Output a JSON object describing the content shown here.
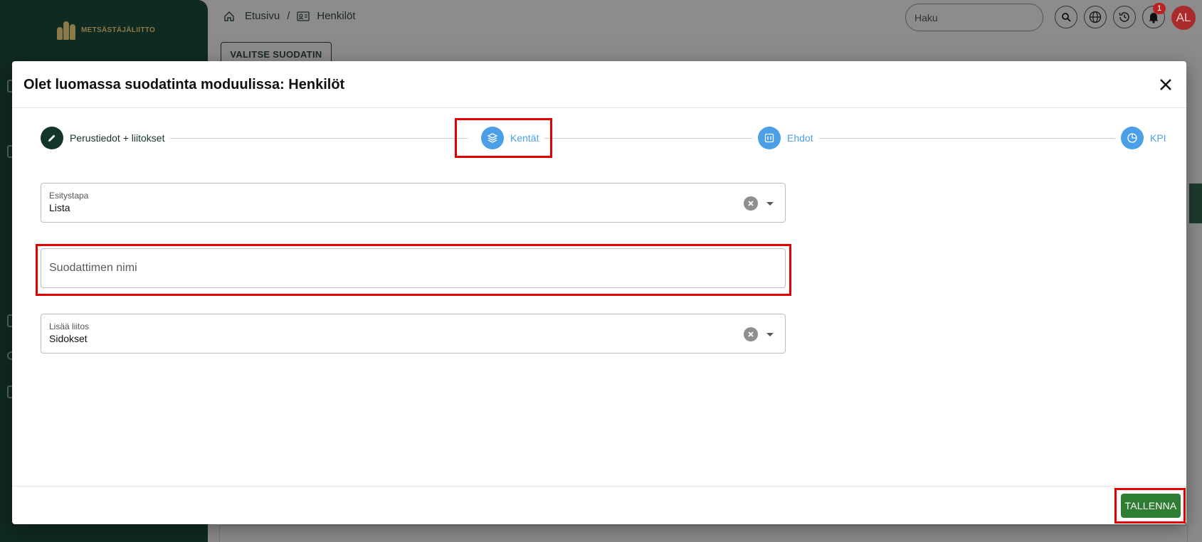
{
  "app": {
    "logo_text": "METSÄSTÄJÄLIITTO"
  },
  "breadcrumb": {
    "home": "Etusivu",
    "separator": "/",
    "current": "Henkilöt"
  },
  "search": {
    "placeholder": "Haku"
  },
  "toolbar": {
    "notification_count": "1",
    "avatar_initials": "AL",
    "filter_button": "VALITSE SUODATIN"
  },
  "modal": {
    "title": "Olet luomassa suodatinta moduulissa: Henkilöt",
    "steps": [
      {
        "label": "Perustiedot + liitokset",
        "icon": "pencil-icon",
        "state": "done"
      },
      {
        "label": "Kentät",
        "icon": "layers-icon",
        "state": "active"
      },
      {
        "label": "Ehdot",
        "icon": "grid-icon",
        "state": "pending"
      },
      {
        "label": "KPI",
        "icon": "pie-chart-icon",
        "state": "pending"
      }
    ],
    "fields": {
      "presentation": {
        "label": "Esitystapa",
        "value": "Lista"
      },
      "filter_name": {
        "placeholder": "Suodattimen nimi",
        "value": ""
      },
      "add_join": {
        "label": "Lisää liitos",
        "value": "Sidokset"
      }
    },
    "save_button": "TALLENNA"
  },
  "colors": {
    "sidebar": "#0f2a20",
    "step_done": "#14352a",
    "step_active": "#4a9fe6",
    "step_pending": "#4a9fe6",
    "save": "#2e7d32",
    "highlight": "#e00000",
    "avatar": "#a92b2b"
  }
}
